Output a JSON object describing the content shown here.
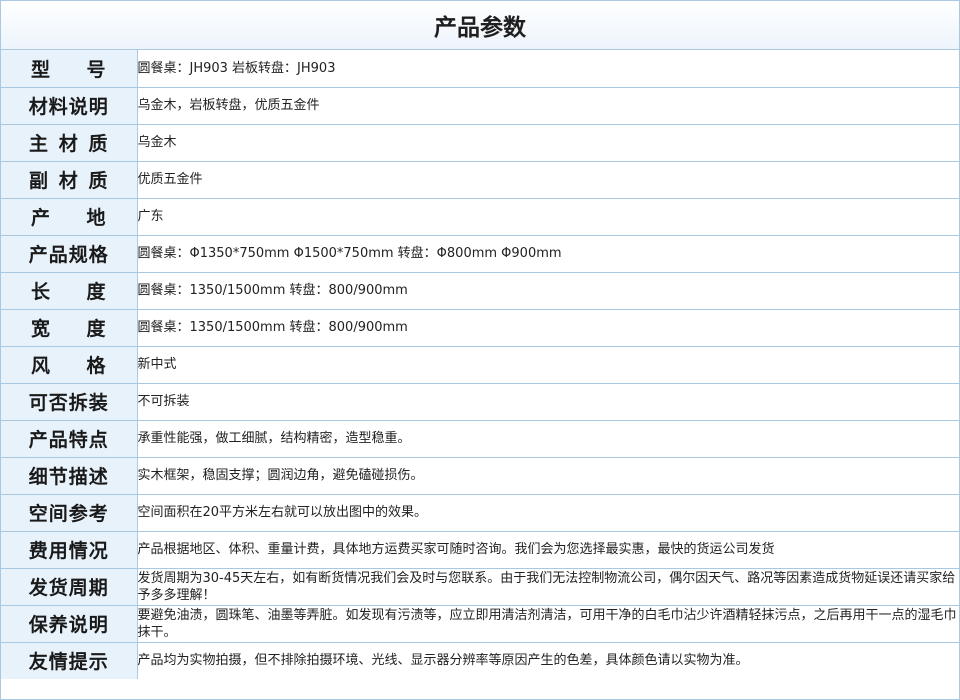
{
  "header": {
    "title": "产品参数"
  },
  "rows": [
    {
      "label": "型号",
      "value": "圆餐桌：JH903  岩板转盘：JH903"
    },
    {
      "label": "材料说明",
      "value": "乌金木，岩板转盘，优质五金件"
    },
    {
      "label": "主材质",
      "value": "乌金木"
    },
    {
      "label": "副材质",
      "value": "优质五金件"
    },
    {
      "label": "产地",
      "value": "广东"
    },
    {
      "label": "产品规格",
      "value": "圆餐桌：Φ1350*750mm  Φ1500*750mm  转盘：Φ800mm  Φ900mm"
    },
    {
      "label": "长度",
      "value": "圆餐桌：1350/1500mm  转盘：800/900mm"
    },
    {
      "label": "宽度",
      "value": "圆餐桌：1350/1500mm  转盘：800/900mm"
    },
    {
      "label": "风格",
      "value": "新中式"
    },
    {
      "label": "可否拆装",
      "value": "不可拆装"
    },
    {
      "label": "产品特点",
      "value": "承重性能强，做工细腻，结构精密，造型稳重。"
    },
    {
      "label": "细节描述",
      "value": "实木框架，稳固支撑；圆润边角，避免磕碰损伤。"
    },
    {
      "label": "空间参考",
      "value": "空间面积在20平方米左右就可以放出图中的效果。"
    },
    {
      "label": "费用情况",
      "value": "产品根据地区、体积、重量计费，具体地方运费买家可随时咨询。我们会为您选择最实惠，最快的货运公司发货"
    },
    {
      "label": "发货周期",
      "value": "发货周期为30-45天左右，如有断货情况我们会及时与您联系。由于我们无法控制物流公司，偶尔因天气、路况等因素造成货物延误还请买家给予多多理解！"
    },
    {
      "label": "保养说明",
      "value": "要避免油渍，圆珠笔、油墨等弄脏。如发现有污渍等，应立即用清洁剂清洁，可用干净的白毛巾沾少许酒精轻抹污点，之后再用干一点的湿毛巾抹干。"
    },
    {
      "label": "友情提示",
      "value": "产品均为实物拍摄，但不排除拍摄环境、光线、显示器分辨率等原因产生的色差，具体颜色请以实物为准。"
    }
  ]
}
